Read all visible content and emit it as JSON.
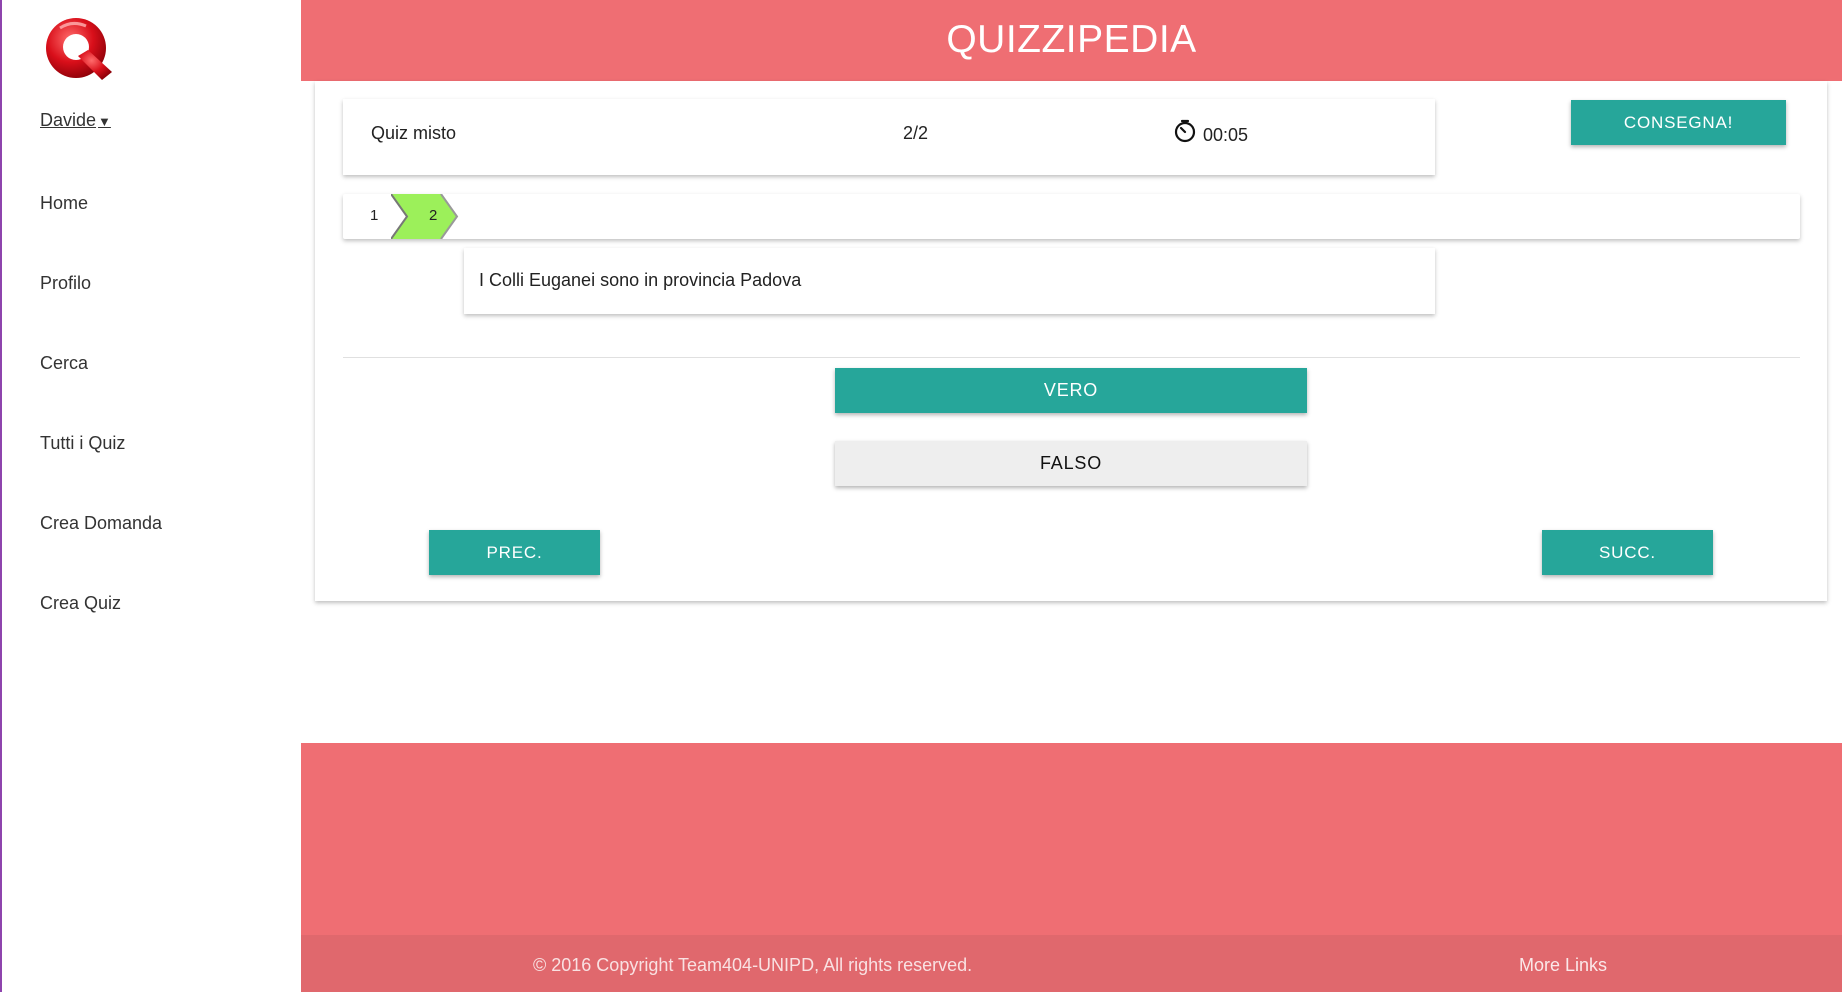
{
  "app": {
    "title": "QUIZZIPEDIA",
    "accent": "#ef6e73",
    "button_color": "#26a69a"
  },
  "sidebar": {
    "user_name": "Davide",
    "items": [
      {
        "label": "Home"
      },
      {
        "label": "Profilo"
      },
      {
        "label": "Cerca"
      },
      {
        "label": "Tutti i Quiz"
      },
      {
        "label": "Crea Domanda"
      },
      {
        "label": "Crea Quiz"
      }
    ]
  },
  "quiz": {
    "name": "Quiz misto",
    "progress": "2/2",
    "timer": "00:05",
    "submit_label": "CONSEGNA!",
    "steps": [
      {
        "label": "1",
        "active": false
      },
      {
        "label": "2",
        "active": true,
        "color": "#9cf05a"
      }
    ],
    "question": "I Colli Euganei sono in provincia Padova",
    "answers": {
      "true_label": "VERO",
      "false_label": "FALSO"
    },
    "prev_label": "PREC.",
    "next_label": "SUCC."
  },
  "footer": {
    "copyright": "© 2016 Copyright Team404-UNIPD, All rights reserved.",
    "more_links": "More Links"
  }
}
